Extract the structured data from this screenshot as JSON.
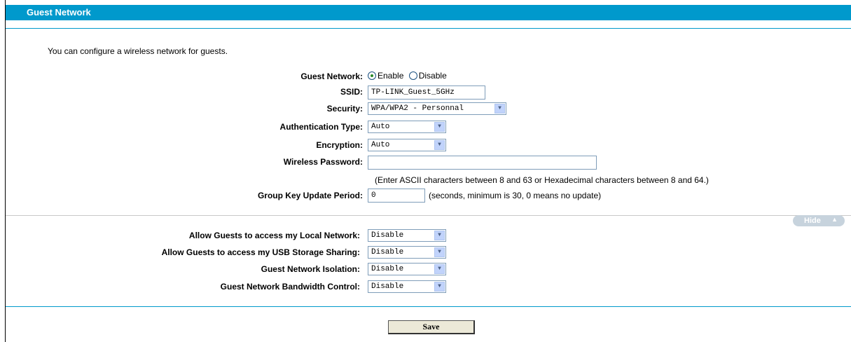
{
  "header": {
    "title": "Guest Network"
  },
  "intro": "You can configure a wireless network for guests.",
  "guest_network": {
    "label": "Guest Network:",
    "enable_label": "Enable",
    "disable_label": "Disable",
    "selected": "Enable"
  },
  "ssid": {
    "label": "SSID:",
    "value": "TP-LINK_Guest_5GHz"
  },
  "security": {
    "label": "Security:",
    "value": "WPA/WPA2 - Personnal"
  },
  "auth_type": {
    "label": "Authentication Type:",
    "value": "Auto"
  },
  "encryption": {
    "label": "Encryption:",
    "value": "Auto"
  },
  "password": {
    "label": "Wireless Password:",
    "value": "",
    "hint": "(Enter ASCII characters between 8 and 63 or Hexadecimal characters between 8 and 64.)"
  },
  "group_key": {
    "label": "Group Key Update Period:",
    "value": "0",
    "hint": "(seconds, minimum is 30, 0 means no update)"
  },
  "hide_button": {
    "label": "Hide"
  },
  "advanced": {
    "local_network": {
      "label": "Allow Guests to access my Local Network:",
      "value": "Disable"
    },
    "usb_sharing": {
      "label": "Allow Guests to access my USB Storage Sharing:",
      "value": "Disable"
    },
    "isolation": {
      "label": "Guest Network Isolation:",
      "value": "Disable"
    },
    "bandwidth": {
      "label": "Guest Network Bandwidth Control:",
      "value": "Disable"
    }
  },
  "save_button": {
    "label": "Save"
  },
  "colors": {
    "header": "#0099cc",
    "rule": "#0099cc"
  }
}
